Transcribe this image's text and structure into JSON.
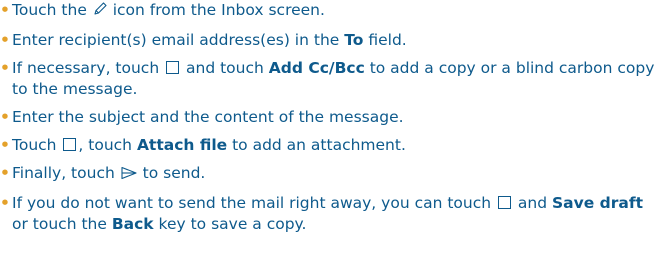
{
  "bullet_char": "•",
  "items": [
    {
      "pre": "Touch the ",
      "icon": "pencil-compose-icon",
      "post": " icon from the Inbox screen."
    },
    {
      "pre": "Enter recipient(s) email address(es) in the ",
      "bold": "To",
      "post": " field."
    },
    {
      "pre": "If necessary, touch ",
      "icon": "menu-box-icon",
      "mid": " and touch ",
      "bold": "Add Cc/Bcc",
      "post": " to add a copy or a blind carbon copy to the message."
    },
    {
      "text": "Enter the subject and the content of the message."
    },
    {
      "pre": "Touch ",
      "icon": "menu-box-icon",
      "mid": ", touch ",
      "bold": "Attach file",
      "post": " to add an attachment."
    },
    {
      "pre": "Finally, touch ",
      "icon": "send-arrow-icon",
      "post": " to send."
    },
    {
      "pre": "If you do not want to send the mail right away, you can touch ",
      "icon": "menu-box-icon",
      "mid": " and ",
      "bold": "Save draft",
      "mid2": " or touch the ",
      "bold2": "Back",
      "post": " key to save a copy."
    }
  ],
  "colors": {
    "text": "#0e5a8c",
    "bullet": "#e4a12a"
  }
}
